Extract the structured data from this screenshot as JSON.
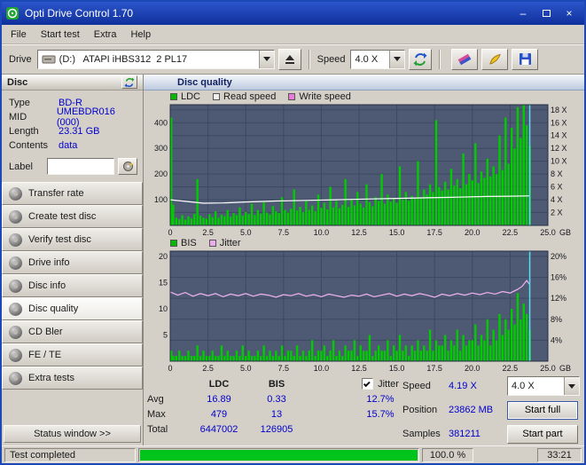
{
  "window": {
    "title": "Opti Drive Control 1.70"
  },
  "menu": {
    "items": [
      "File",
      "Start test",
      "Extra",
      "Help"
    ]
  },
  "toolbar": {
    "drive_label": "Drive",
    "drive_value": "(D:)   ATAPI iHBS312  2 PL17",
    "speed_label": "Speed",
    "speed_value": "4.0 X"
  },
  "disc": {
    "title": "Disc",
    "fields": [
      {
        "label": "Type",
        "value": "BD-R"
      },
      {
        "label": "MID",
        "value": "UMEBDR016 (000)"
      },
      {
        "label": "Length",
        "value": "23.31 GB"
      },
      {
        "label": "Contents",
        "value": "data"
      }
    ],
    "label_caption": "Label"
  },
  "nav": {
    "items": [
      {
        "label": "Transfer rate"
      },
      {
        "label": "Create test disc"
      },
      {
        "label": "Verify test disc"
      },
      {
        "label": "Drive info"
      },
      {
        "label": "Disc info"
      },
      {
        "label": "Disc quality"
      },
      {
        "label": "CD Bler"
      },
      {
        "label": "FE / TE"
      },
      {
        "label": "Extra tests"
      }
    ],
    "active_item": "Disc quality",
    "status_window": "Status window >>"
  },
  "main": {
    "title": "Disc quality"
  },
  "stats": {
    "ldc_header": "LDC",
    "bis_header": "BIS",
    "jitter_label": "Jitter",
    "rows": [
      {
        "label": "Avg",
        "ldc": "16.89",
        "bis": "0.33",
        "jitter": "12.7%"
      },
      {
        "label": "Max",
        "ldc": "479",
        "bis": "13",
        "jitter": "15.7%"
      },
      {
        "label": "Total",
        "ldc": "6447002",
        "bis": "126905",
        "jitter": ""
      }
    ],
    "speed_label": "Speed",
    "speed_value": "4.19 X",
    "speed_combo": "4.0 X",
    "position_label": "Position",
    "position_value": "23862 MB",
    "samples_label": "Samples",
    "samples_value": "381211",
    "start_full": "Start full",
    "start_part": "Start part"
  },
  "statusbar": {
    "text": "Test completed",
    "progress": "100.0 %",
    "progress_pct": 100,
    "time": "33:21"
  },
  "chart_data": [
    {
      "type": "bar",
      "name": "ldc-read-speed-chart",
      "bg_color": "#4e5a74",
      "grid_color": "#3d4962",
      "border_color": "#262e44",
      "x_max": 25,
      "x_ticks": {
        "values": [
          0,
          2.5,
          5,
          7.5,
          10,
          12.5,
          15,
          17.5,
          20,
          22.5,
          25
        ],
        "labels": [
          "0",
          "2.5",
          "5.0",
          "7.5",
          "10.0",
          "12.5",
          "15.0",
          "17.5",
          "20.0",
          "22.5",
          "25.0"
        ],
        "unit": "GB"
      },
      "left_axis": {
        "max": 470,
        "ticks": [
          100,
          200,
          300,
          400
        ]
      },
      "right_axis": {
        "max": 18.8,
        "ticks": [
          2,
          4,
          6,
          8,
          10,
          12,
          14,
          16,
          18
        ],
        "suffix": " X"
      },
      "legend": [
        {
          "label": "LDC",
          "color": "#00bb00"
        },
        {
          "label": "Read speed",
          "color": "#f0f0f0"
        },
        {
          "label": "Write speed",
          "color": "#e87ad8"
        }
      ],
      "bars": {
        "color": "#00cc00",
        "step_gb": 0.2,
        "values": [
          420,
          80,
          30,
          25,
          40,
          22,
          35,
          28,
          45,
          180,
          38,
          30,
          26,
          44,
          32,
          55,
          30,
          42,
          36,
          60,
          34,
          48,
          40,
          70,
          38,
          52,
          44,
          85,
          40,
          60,
          46,
          90,
          50,
          42,
          75,
          55,
          48,
          110,
          60,
          50,
          65,
          140,
          58,
          72,
          52,
          95,
          60,
          78,
          55,
          120,
          68,
          88,
          62,
          150,
          70,
          95,
          66,
          80,
          180,
          72,
          100,
          78,
          130,
          85,
          70,
          160,
          90,
          75,
          110,
          95,
          200,
          85,
          120,
          92,
          105,
          88,
          230,
          100,
          130,
          96,
          115,
          105,
          250,
          110,
          140,
          120,
          160,
          130,
          410,
          150,
          135,
          170,
          140,
          220,
          155,
          180,
          145,
          280,
          160,
          200,
          175,
          320,
          165,
          210,
          185,
          260,
          190,
          230,
          200,
          350,
          215,
          420,
          240,
          380,
          300,
          460,
          340,
          479,
          390,
          310,
          0,
          0,
          0,
          0,
          0
        ]
      },
      "lines": [
        {
          "name": "read-speed",
          "axis": "right",
          "color": "#ffffff",
          "points": [
            [
              0,
              4.0
            ],
            [
              1,
              3.75
            ],
            [
              2.2,
              3.45
            ],
            [
              3.5,
              3.5
            ],
            [
              5,
              3.65
            ],
            [
              7,
              3.8
            ],
            [
              9,
              3.9
            ],
            [
              11,
              4.0
            ],
            [
              13,
              4.1
            ],
            [
              15,
              4.2
            ],
            [
              17,
              4.3
            ],
            [
              19,
              4.4
            ],
            [
              21,
              4.5
            ],
            [
              22.5,
              4.55
            ],
            [
              23.8,
              4.6
            ]
          ]
        }
      ],
      "marker": {
        "gb": 23.8,
        "color": "#55dff0"
      }
    },
    {
      "type": "bar",
      "name": "bis-jitter-chart",
      "bg_color": "#4e5a74",
      "grid_color": "#3d4962",
      "border_color": "#262e44",
      "x_max": 25,
      "x_ticks": {
        "values": [
          0,
          2.5,
          5,
          7.5,
          10,
          12.5,
          15,
          17.5,
          20,
          22.5,
          25
        ],
        "labels": [
          "0",
          "2.5",
          "5.0",
          "7.5",
          "10.0",
          "12.5",
          "15.0",
          "17.5",
          "20.0",
          "22.5",
          "25.0"
        ],
        "unit": "GB"
      },
      "left_axis": {
        "max": 21,
        "ticks": [
          5,
          10,
          15,
          20
        ]
      },
      "right_axis": {
        "max": 21,
        "ticks": [
          4,
          8,
          12,
          16,
          20
        ],
        "suffix": "%"
      },
      "legend": [
        {
          "label": "BIS",
          "color": "#00bb00"
        },
        {
          "label": "Jitter",
          "color": "#eeaaee"
        }
      ],
      "bars": {
        "color": "#00cc00",
        "step_gb": 0.2,
        "values": [
          2,
          1,
          1,
          2,
          1,
          1,
          2,
          1,
          1,
          3,
          1,
          2,
          1,
          1,
          2,
          1,
          1,
          3,
          1,
          2,
          1,
          1,
          2,
          1,
          3,
          1,
          2,
          1,
          1,
          2,
          1,
          3,
          1,
          2,
          1,
          2,
          1,
          3,
          1,
          2,
          2,
          1,
          3,
          1,
          2,
          1,
          2,
          4,
          1,
          2,
          2,
          3,
          1,
          2,
          4,
          1,
          2,
          1,
          3,
          2,
          2,
          4,
          1,
          3,
          2,
          2,
          5,
          1,
          2,
          3,
          2,
          2,
          4,
          1,
          3,
          2,
          5,
          2,
          3,
          1,
          3,
          2,
          4,
          2,
          3,
          2,
          6,
          2,
          4,
          3,
          3,
          5,
          2,
          4,
          3,
          6,
          2,
          5,
          3,
          4,
          4,
          7,
          3,
          5,
          4,
          8,
          3,
          6,
          4,
          9,
          5,
          8,
          6,
          10,
          7,
          13,
          8,
          11,
          9,
          6,
          0,
          0,
          0,
          0,
          0
        ]
      },
      "lines": [
        {
          "name": "jitter",
          "axis": "right",
          "color": "#f2b2f2",
          "points": [
            [
              0,
              13.2
            ],
            [
              0.5,
              12.6
            ],
            [
              1,
              13.1
            ],
            [
              1.5,
              12.4
            ],
            [
              2,
              12.9
            ],
            [
              2.5,
              12.5
            ],
            [
              3,
              12.9
            ],
            [
              3.5,
              12.3
            ],
            [
              4,
              12.8
            ],
            [
              4.5,
              12.5
            ],
            [
              5,
              12.9
            ],
            [
              5.5,
              12.4
            ],
            [
              6,
              12.8
            ],
            [
              6.5,
              12.6
            ],
            [
              7,
              12.2
            ],
            [
              7.5,
              12.7
            ],
            [
              8,
              12.5
            ],
            [
              8.5,
              12.9
            ],
            [
              9,
              12.4
            ],
            [
              9.5,
              12.7
            ],
            [
              10,
              12.3
            ],
            [
              10.5,
              12.8
            ],
            [
              11,
              12.5
            ],
            [
              11.5,
              12.2
            ],
            [
              12,
              12.6
            ],
            [
              12.5,
              12.4
            ],
            [
              13,
              12.8
            ],
            [
              13.5,
              12.3
            ],
            [
              14,
              12.6
            ],
            [
              14.5,
              12.9
            ],
            [
              15,
              12.4
            ],
            [
              15.5,
              12.8
            ],
            [
              16,
              12.5
            ],
            [
              16.5,
              12.9
            ],
            [
              17,
              12.6
            ],
            [
              17.5,
              12.2
            ],
            [
              18,
              12.8
            ],
            [
              18.5,
              12.5
            ],
            [
              19,
              12.9
            ],
            [
              19.5,
              12.6
            ],
            [
              20,
              13.0
            ],
            [
              20.5,
              12.7
            ],
            [
              21,
              13.1
            ],
            [
              21.5,
              12.8
            ],
            [
              22,
              13.3
            ],
            [
              22.5,
              13.0
            ],
            [
              23,
              13.7
            ],
            [
              23.3,
              14.3
            ],
            [
              23.6,
              15.4
            ],
            [
              23.8,
              14.6
            ]
          ]
        }
      ],
      "marker": {
        "gb": 23.8,
        "color": "#55dff0"
      }
    }
  ]
}
